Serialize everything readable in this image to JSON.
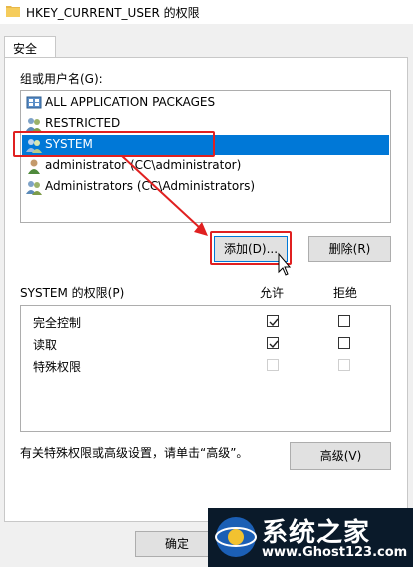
{
  "window": {
    "title": "HKEY_CURRENT_USER 的权限"
  },
  "tabs": [
    {
      "label": "安全"
    }
  ],
  "groups": {
    "label": "组或用户名(G):",
    "items": [
      {
        "name": "ALL APPLICATION PACKAGES",
        "icon": "app-packages-icon"
      },
      {
        "name": "RESTRICTED",
        "icon": "users-group-icon"
      },
      {
        "name": "SYSTEM",
        "icon": "users-group-icon",
        "selected": true
      },
      {
        "name": "administrator (CC\\administrator)",
        "icon": "user-icon"
      },
      {
        "name": "Administrators (CC\\Administrators)",
        "icon": "users-group-icon"
      }
    ]
  },
  "buttons": {
    "add": "添加(D)...",
    "remove": "删除(R)",
    "advanced": "高级(V)",
    "ok": "确定"
  },
  "permissions": {
    "label": "SYSTEM 的权限(P)",
    "allow_header": "允许",
    "deny_header": "拒绝",
    "items": [
      {
        "name": "完全控制",
        "allow": true,
        "deny": false,
        "enabled": true
      },
      {
        "name": "读取",
        "allow": true,
        "deny": false,
        "enabled": true
      },
      {
        "name": "特殊权限",
        "allow": false,
        "deny": false,
        "enabled": false
      }
    ]
  },
  "advanced_hint": "有关特殊权限或高级设置，请单击“高级”。",
  "watermark": {
    "text": "系统之家",
    "url": "www.Ghost123.com"
  },
  "colors": {
    "selection": "#0078d7",
    "annotation": "#e02020"
  }
}
